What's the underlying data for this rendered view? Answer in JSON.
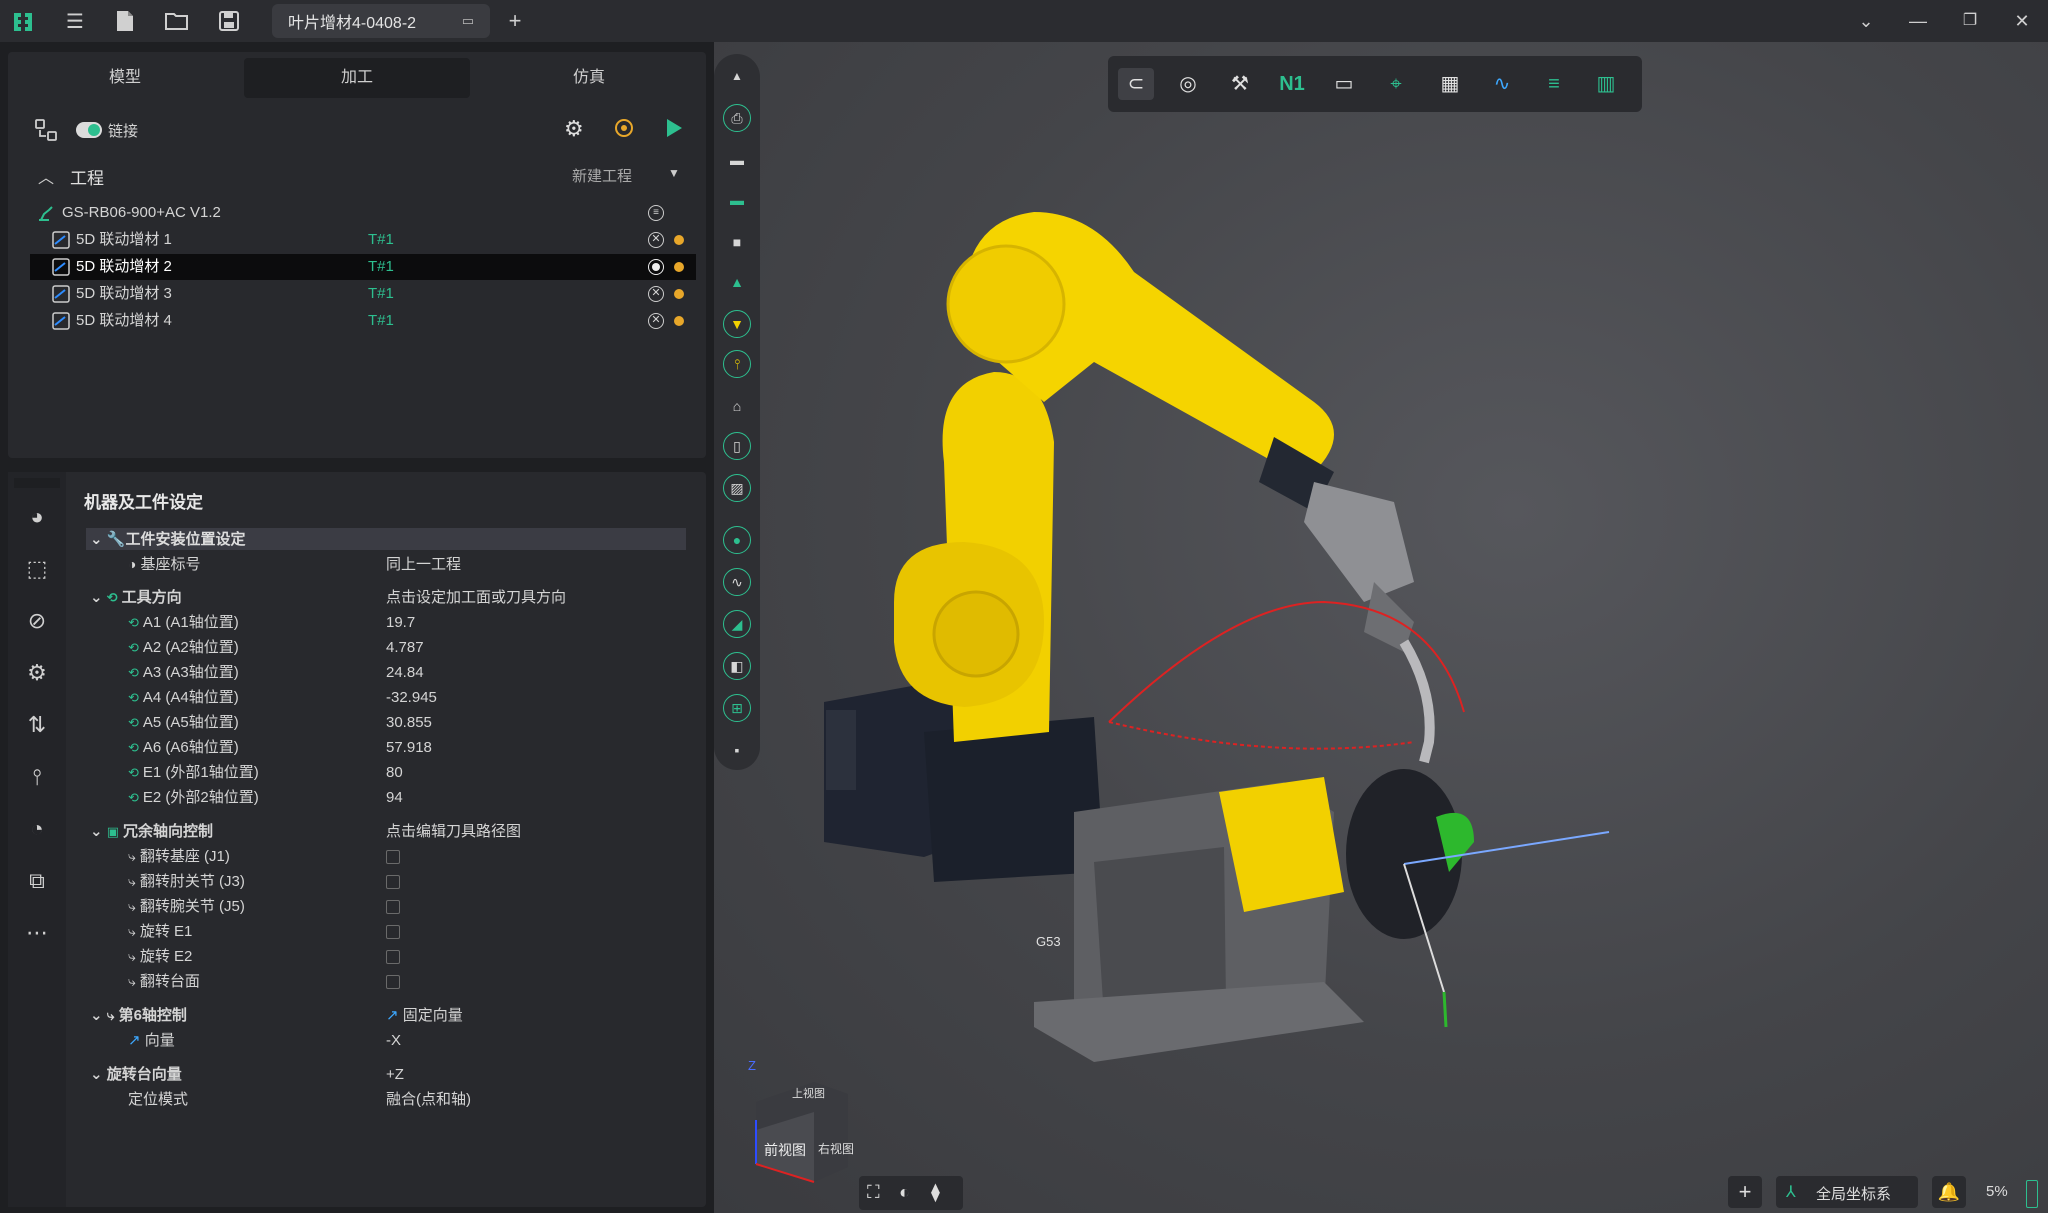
{
  "titlebar": {
    "tab_title": "叶片增材4-0408-2",
    "add_tab": "+",
    "icons": [
      "logo-icon",
      "menu-icon",
      "new-file-icon",
      "open-folder-icon",
      "save-icon"
    ]
  },
  "top_panel": {
    "tabs": [
      "模型",
      "加工",
      "仿真"
    ],
    "active_tab": 1,
    "link_label": "链接",
    "project_header": "工程",
    "new_project": "新建工程",
    "machine": "GS-RB06-900+AC V1.2",
    "items": [
      {
        "name": "5D 联动增材 1",
        "tool": "T#1"
      },
      {
        "name": "5D 联动增材 2",
        "tool": "T#1"
      },
      {
        "name": "5D 联动增材 3",
        "tool": "T#1"
      },
      {
        "name": "5D 联动增材 4",
        "tool": "T#1"
      }
    ],
    "selected_index": 1
  },
  "settings": {
    "title": "机器及工件设定",
    "sec_install": "工件安装位置设定",
    "base_label": "基座标号",
    "base_value": "同上一工程",
    "sec_tool_dir": "工具方向",
    "tool_dir_value": "点击设定加工面或刀具方向",
    "axes": [
      {
        "label": "A1 (A1轴位置)",
        "value": "19.7"
      },
      {
        "label": "A2 (A2轴位置)",
        "value": "4.787"
      },
      {
        "label": "A3 (A3轴位置)",
        "value": "24.84"
      },
      {
        "label": "A4 (A4轴位置)",
        "value": "-32.945"
      },
      {
        "label": "A5 (A5轴位置)",
        "value": "30.855"
      },
      {
        "label": "A6 (A6轴位置)",
        "value": "57.918"
      },
      {
        "label": "E1 (外部1轴位置)",
        "value": "80"
      },
      {
        "label": "E2 (外部2轴位置)",
        "value": "94"
      }
    ],
    "sec_redundant": "冗余轴向控制",
    "redundant_value": "点击编辑刀具路径图",
    "flips": [
      "翻转基座 (J1)",
      "翻转肘关节 (J3)",
      "翻转腕关节 (J5)",
      "旋转  E1",
      "旋转  E2",
      "翻转台面"
    ],
    "sec_axis6": "第6轴控制",
    "axis6_value": "固定向量",
    "vector_label": "向量",
    "vector_value": "-X",
    "sec_rotary": "旋转台向量",
    "rotary_value": "+Z",
    "position_label": "定位模式",
    "position_value": "融合(点和轴)"
  },
  "viewport": {
    "toolbar_n1": "N1",
    "label_g53": "G53",
    "cube_top": "上视图",
    "cube_front": "前视图",
    "cube_right": "右视图",
    "axis_z": "Z"
  },
  "status": {
    "coord_system": "全局坐标系",
    "zoom": "5%",
    "add": "+"
  },
  "colors": {
    "accent": "#2dbf8f",
    "robot_yellow": "#f5d200",
    "orange_dot": "#e8a72a"
  }
}
